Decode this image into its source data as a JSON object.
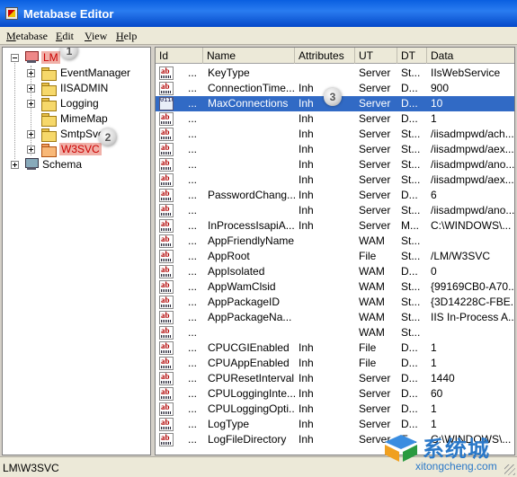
{
  "window": {
    "title": "Metabase Editor"
  },
  "menu": [
    {
      "label": "Metabase",
      "accel": "M",
      "rest": "etabase"
    },
    {
      "label": "Edit",
      "accel": "E",
      "rest": "dit"
    },
    {
      "label": "View",
      "accel": "V",
      "rest": "iew"
    },
    {
      "label": "Help",
      "accel": "H",
      "rest": "elp"
    }
  ],
  "tree": {
    "root": "LM",
    "children": [
      "EventManager",
      "IISADMIN",
      "Logging",
      "MimeMap",
      "SmtpSvc",
      "W3SVC"
    ],
    "schema": "Schema"
  },
  "annotations": [
    "1",
    "2",
    "3"
  ],
  "list": {
    "columns": [
      "Id",
      "Name",
      "Attributes",
      "UT",
      "DT",
      "Data"
    ],
    "rows": [
      {
        "icon": "ab",
        "id": "...",
        "name": "KeyType",
        "attr": "",
        "ut": "Server",
        "dt": "St...",
        "data": "IIsWebService"
      },
      {
        "icon": "ab",
        "id": "...",
        "name": "ConnectionTime...",
        "attr": "Inh",
        "ut": "Server",
        "dt": "D...",
        "data": "900"
      },
      {
        "icon": "bin",
        "id": "...",
        "name": "MaxConnections",
        "attr": "Inh",
        "ut": "Server",
        "dt": "D...",
        "data": "10",
        "selected": true
      },
      {
        "icon": "ab",
        "id": "...",
        "name": "",
        "attr": "Inh",
        "ut": "Server",
        "dt": "D...",
        "data": "1"
      },
      {
        "icon": "ab",
        "id": "...",
        "name": "",
        "attr": "Inh",
        "ut": "Server",
        "dt": "St...",
        "data": "/iisadmpwd/ach..."
      },
      {
        "icon": "ab",
        "id": "...",
        "name": "",
        "attr": "Inh",
        "ut": "Server",
        "dt": "St...",
        "data": "/iisadmpwd/aex..."
      },
      {
        "icon": "ab",
        "id": "...",
        "name": "",
        "attr": "Inh",
        "ut": "Server",
        "dt": "St...",
        "data": "/iisadmpwd/ano..."
      },
      {
        "icon": "ab",
        "id": "...",
        "name": "",
        "attr": "Inh",
        "ut": "Server",
        "dt": "St...",
        "data": "/iisadmpwd/aex..."
      },
      {
        "icon": "ab",
        "id": "...",
        "name": "PasswordChang...",
        "attr": "Inh",
        "ut": "Server",
        "dt": "D...",
        "data": "6"
      },
      {
        "icon": "ab",
        "id": "...",
        "name": "",
        "attr": "Inh",
        "ut": "Server",
        "dt": "St...",
        "data": "/iisadmpwd/ano..."
      },
      {
        "icon": "ab",
        "id": "...",
        "name": "InProcessIsapiA...",
        "attr": "Inh",
        "ut": "Server",
        "dt": "M...",
        "data": "C:\\WINDOWS\\..."
      },
      {
        "icon": "ab",
        "id": "...",
        "name": "AppFriendlyName",
        "attr": "",
        "ut": "WAM",
        "dt": "St...",
        "data": ""
      },
      {
        "icon": "ab",
        "id": "...",
        "name": "AppRoot",
        "attr": "",
        "ut": "File",
        "dt": "St...",
        "data": "/LM/W3SVC"
      },
      {
        "icon": "ab",
        "id": "...",
        "name": "AppIsolated",
        "attr": "",
        "ut": "WAM",
        "dt": "D...",
        "data": "0"
      },
      {
        "icon": "ab",
        "id": "...",
        "name": "AppWamClsid",
        "attr": "",
        "ut": "WAM",
        "dt": "St...",
        "data": "{99169CB0-A70..."
      },
      {
        "icon": "ab",
        "id": "...",
        "name": "AppPackageID",
        "attr": "",
        "ut": "WAM",
        "dt": "St...",
        "data": "{3D14228C-FBE..."
      },
      {
        "icon": "ab",
        "id": "...",
        "name": "AppPackageNa...",
        "attr": "",
        "ut": "WAM",
        "dt": "St...",
        "data": "IIS In-Process A..."
      },
      {
        "icon": "ab",
        "id": "...",
        "name": "",
        "attr": "",
        "ut": "WAM",
        "dt": "St...",
        "data": ""
      },
      {
        "icon": "ab",
        "id": "...",
        "name": "CPUCGIEnabled",
        "attr": "Inh",
        "ut": "File",
        "dt": "D...",
        "data": "1"
      },
      {
        "icon": "ab",
        "id": "...",
        "name": "CPUAppEnabled",
        "attr": "Inh",
        "ut": "File",
        "dt": "D...",
        "data": "1"
      },
      {
        "icon": "ab",
        "id": "...",
        "name": "CPUResetInterval",
        "attr": "Inh",
        "ut": "Server",
        "dt": "D...",
        "data": "1440"
      },
      {
        "icon": "ab",
        "id": "...",
        "name": "CPULoggingInte...",
        "attr": "Inh",
        "ut": "Server",
        "dt": "D...",
        "data": "60"
      },
      {
        "icon": "ab",
        "id": "...",
        "name": "CPULoggingOpti...",
        "attr": "Inh",
        "ut": "Server",
        "dt": "D...",
        "data": "1"
      },
      {
        "icon": "ab",
        "id": "...",
        "name": "LogType",
        "attr": "Inh",
        "ut": "Server",
        "dt": "D...",
        "data": "1"
      },
      {
        "icon": "ab",
        "id": "...",
        "name": "LogFileDirectory",
        "attr": "Inh",
        "ut": "Server",
        "dt": "E...",
        "data": "C:\\WINDOWS\\..."
      }
    ]
  },
  "status": {
    "path": "LM\\W3SVC"
  },
  "watermark": {
    "cn": "系统城",
    "en": "xitongcheng.com"
  },
  "colors": {
    "selection": "#316ac5",
    "title_bar": "#0a5fe0",
    "highlight": "#f0b0a8",
    "watermark": "#2a78c8"
  }
}
